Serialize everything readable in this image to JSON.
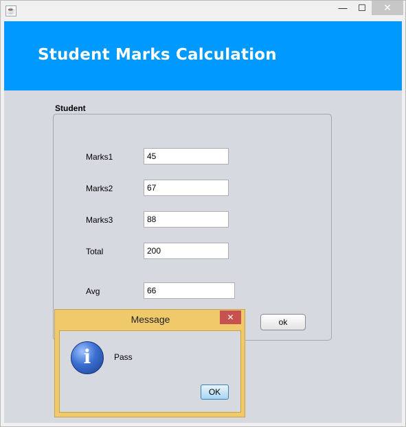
{
  "window": {
    "icon": "java-coffee-icon",
    "controls": {
      "minimize": "—",
      "maximize": "☐",
      "close": "✕"
    }
  },
  "header": {
    "title": "Student Marks Calculation",
    "background": "#0099ff"
  },
  "form": {
    "group_label": "Student",
    "fields": [
      {
        "label": "Marks1",
        "value": "45"
      },
      {
        "label": "Marks2",
        "value": "67"
      },
      {
        "label": "Marks3",
        "value": "88"
      },
      {
        "label": "Total",
        "value": "200"
      },
      {
        "label": "Avg",
        "value": "66"
      }
    ],
    "ok_label": "ok"
  },
  "dialog": {
    "title": "Message",
    "close": "✕",
    "icon": "info-icon",
    "message": "Pass",
    "ok_label": "OK"
  }
}
